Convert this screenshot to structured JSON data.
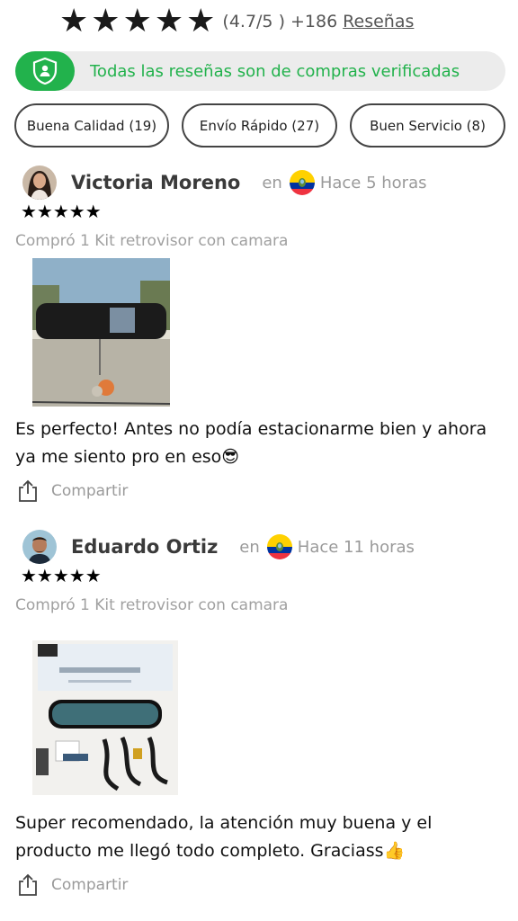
{
  "summary": {
    "stars": [
      "★",
      "★",
      "★",
      "★",
      "★"
    ],
    "rating": "(4.7/5 )",
    "count": "+186",
    "reviews_link": "Reseñas"
  },
  "verified": {
    "text": "Todas las reseñas son de compras verificadas",
    "icon": "shield-user-icon",
    "color": "#22b24c"
  },
  "filters": [
    {
      "label": "Buena Calidad (19)"
    },
    {
      "label": "Envío Rápido (27)"
    },
    {
      "label": "Buen Servicio (8)"
    }
  ],
  "reviews": [
    {
      "name": "Victoria Moreno",
      "en": "en",
      "flag": "ecuador-flag-icon",
      "time": "Hace 5 horas",
      "stars": "★★★★★",
      "bought": "Compró 1 Kit retrovisor con camara",
      "text": "Es perfecto! Antes no podía estacionarme bien y ahora ya me siento pro en eso😎",
      "share": "Compartir"
    },
    {
      "name": "Eduardo Ortiz",
      "en": "en",
      "flag": "ecuador-flag-icon",
      "time": "Hace 11 horas",
      "stars": "★★★★★",
      "bought": "Compró 1 Kit retrovisor con camara",
      "text": "Super recomendado, la atención muy buena y el producto me llegó todo completo. Graciass👍",
      "share": "Compartir"
    }
  ]
}
